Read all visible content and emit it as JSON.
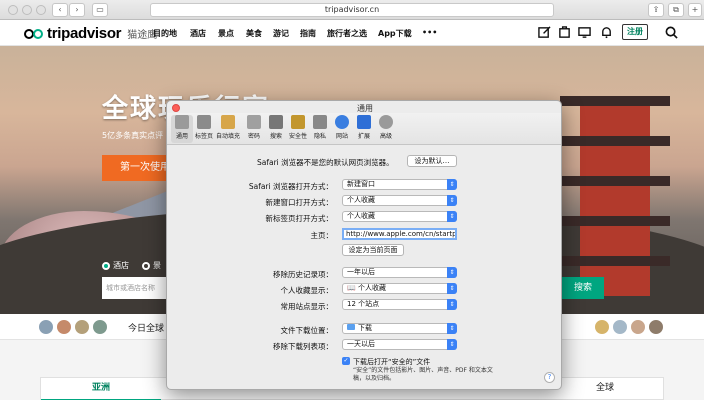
{
  "browser": {
    "url": "tripadvisor.cn",
    "back": "‹",
    "forward": "›"
  },
  "site": {
    "logo": "tripadvisor",
    "logo_cn": "猫途鹰",
    "nav": [
      "目的地",
      "酒店",
      "景点",
      "美食",
      "游记",
      "指南",
      "旅行者之选",
      "App下载",
      "•••"
    ],
    "signup": "注册"
  },
  "hero": {
    "title": "全球玩乐行家",
    "subtitle": "5亿多条真实点评",
    "cta": "第一次使用",
    "radio_hotel": "酒店",
    "radio_other": "景",
    "search_placeholder": "城市或酒店名称",
    "search_button": "搜索"
  },
  "strip": {
    "text": "今日全球"
  },
  "tabs": [
    "亚洲",
    "全球"
  ],
  "dialog": {
    "title": "通用",
    "toolbar": [
      {
        "label": "通用",
        "icon": "switch-icon",
        "color": "#9a9a9a"
      },
      {
        "label": "标签页",
        "icon": "tabs-icon",
        "color": "#8b8b8b"
      },
      {
        "label": "自动填充",
        "icon": "pencil-icon",
        "color": "#d7a64a"
      },
      {
        "label": "密码",
        "icon": "key-icon",
        "color": "#a0a0a0"
      },
      {
        "label": "搜索",
        "icon": "magnifier-icon",
        "color": "#777777"
      },
      {
        "label": "安全性",
        "icon": "lock-icon",
        "color": "#c2962d"
      },
      {
        "label": "隐私",
        "icon": "hand-icon",
        "color": "#888888"
      },
      {
        "label": "网站",
        "icon": "globe-icon",
        "color": "#3a7ee0"
      },
      {
        "label": "扩展",
        "icon": "puzzle-icon",
        "color": "#2f6fd6"
      },
      {
        "label": "高级",
        "icon": "gear-icon",
        "color": "#9a9a9a"
      }
    ],
    "default_browser_text": "Safari 浏览器不是您的默认网页浏览器。",
    "set_default_button": "设为默认…",
    "rows": [
      {
        "label": "Safari 浏览器打开方式：",
        "value": "新建窗口"
      },
      {
        "label": "新建窗口打开方式：",
        "value": "个人收藏"
      },
      {
        "label": "新标签页打开方式：",
        "value": "个人收藏"
      }
    ],
    "homepage_label": "主页：",
    "homepage_value": "http://www.apple.com/cn/startpage/",
    "set_current_button": "设定为当前页面",
    "rows2": [
      {
        "label": "移除历史记录项：",
        "value": "一年以后"
      },
      {
        "label": "个人收藏显示：",
        "value": "📖 个人收藏"
      },
      {
        "label": "常用站点显示：",
        "value": "12 个站点"
      }
    ],
    "rows3": [
      {
        "label": "文件下载位置：",
        "value": "下载"
      },
      {
        "label": "移除下载列表项：",
        "value": "一天以后"
      }
    ],
    "checkbox_label": "下载后打开“安全的”文件",
    "checkbox_note": "“安全”的文件包括影片、图片、声音、PDF 和文本文稿，以及归档。",
    "help": "?"
  }
}
